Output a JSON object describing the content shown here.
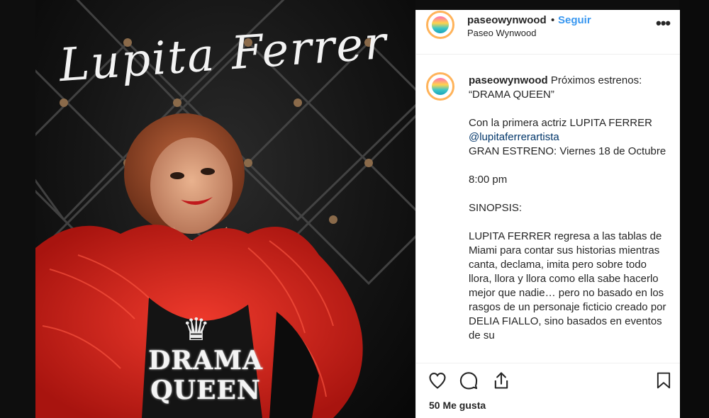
{
  "image_overlay": {
    "title_script": "Lupita Ferrer",
    "logo_line1": "DRAMA",
    "logo_line2": "QUEEN"
  },
  "post": {
    "username": "paseowynwood",
    "separator": "•",
    "follow_label": "Seguir",
    "location": "Paseo Wynwood",
    "more_label": "•••",
    "caption": {
      "username": "paseowynwood",
      "line1": "Próximos estrenos:",
      "line2": "“DRAMA QUEEN”",
      "p2_text": "Con la primera actriz LUPITA FERRER",
      "p2_mention": "@lupitaferrerartista",
      "p2_rest": "GRAN ESTRENO: Viernes 18 de Octubre",
      "p3": "8:00 pm",
      "p4": "SINOPSIS:",
      "p5": "LUPITA FERRER regresa a las tablas de Miami para contar sus historias mientras canta, declama, imita pero sobre todo llora, llora y llora como ella sabe hacerlo mejor que nadie… pero no basado en los rasgos de un personaje ficticio creado por DELIA FIALLO, sino basados en eventos de su"
    },
    "likes": "50 Me gusta"
  },
  "icons": {
    "like": "heart-icon",
    "comment": "comment-icon",
    "share": "share-icon",
    "save": "bookmark-icon"
  },
  "colors": {
    "link": "#3897f0",
    "text": "#262626",
    "feather": "#d8241d"
  }
}
